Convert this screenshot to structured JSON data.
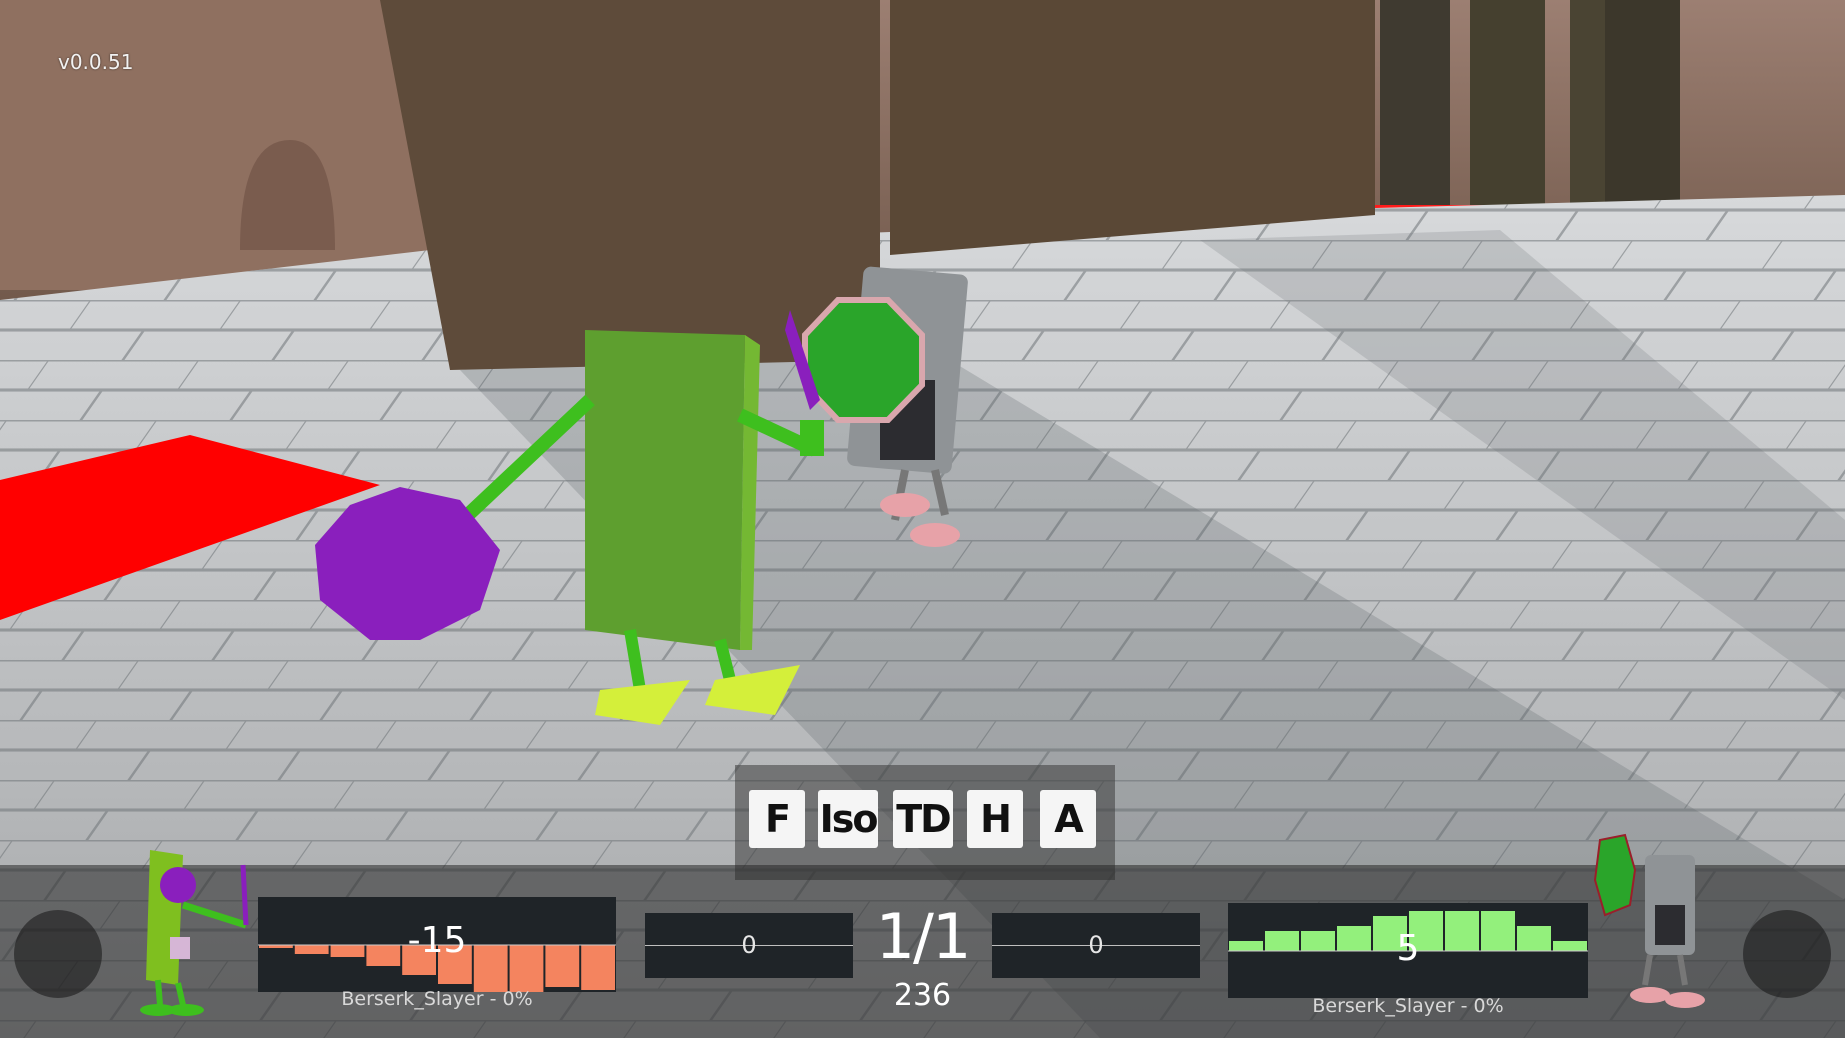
{
  "version": "v0.0.51",
  "camera_modes": [
    {
      "label": "F"
    },
    {
      "label": "Iso"
    },
    {
      "label": "TD"
    },
    {
      "label": "H"
    },
    {
      "label": "A"
    }
  ],
  "hud": {
    "left_player": {
      "score": "-15",
      "name": "Berserk_Slayer - 0%",
      "history": [
        -1,
        -3,
        -4,
        -7,
        -10,
        -13,
        -16,
        -16,
        -14,
        -15
      ],
      "bar_color": "#f4845f"
    },
    "left_mid_value": "0",
    "round": "1/1",
    "timer": "236",
    "right_mid_value": "0",
    "right_player": {
      "score": "5",
      "name": "Berserk_Slayer - 0%",
      "history": [
        2,
        4,
        4,
        5,
        7,
        8,
        8,
        8,
        5,
        2
      ],
      "bar_color": "#93f07c"
    }
  },
  "colors": {
    "player_green": "#6dbb2a",
    "shield_purple": "#8a1fbd",
    "red_zone": "#ff0000"
  }
}
